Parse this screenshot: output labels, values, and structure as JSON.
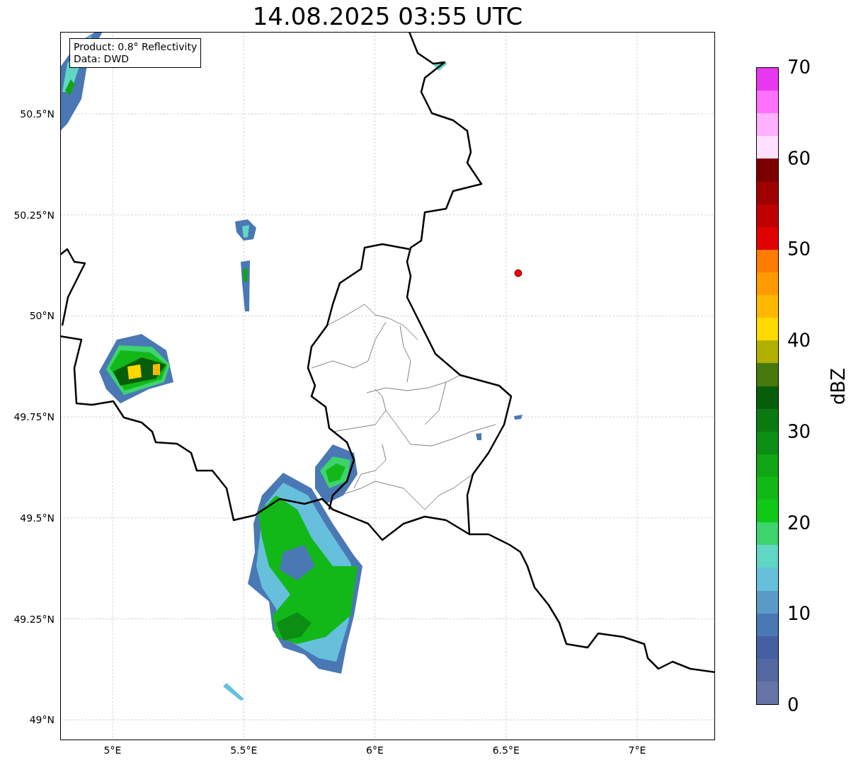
{
  "title": "14.08.2025 03:55 UTC",
  "map": {
    "annotation": [
      "Product: 0.8° Reflectivity",
      "Data: DWD"
    ],
    "y_ticks": [
      "50.5°N",
      "50.25°N",
      "50°N",
      "49.75°N",
      "49.5°N",
      "49.25°N",
      "49°N"
    ],
    "x_ticks": [
      "5°E",
      "5.5°E",
      "6°E",
      "6.5°E",
      "7°E"
    ]
  },
  "colorbar": {
    "label": "dBZ",
    "ticks": [
      "70",
      "60",
      "50",
      "40",
      "30",
      "20",
      "10",
      "0"
    ],
    "bins": [
      {
        "color": "#e838f0"
      },
      {
        "color": "#ff70ff"
      },
      {
        "color": "#ffb0ff"
      },
      {
        "color": "#ffe0ff"
      },
      {
        "color": "#7c0000"
      },
      {
        "color": "#a00000"
      },
      {
        "color": "#c00000"
      },
      {
        "color": "#e00000"
      },
      {
        "color": "#ff7c00"
      },
      {
        "color": "#ff9a00"
      },
      {
        "color": "#ffb800"
      },
      {
        "color": "#ffd800"
      },
      {
        "color": "#b0b000"
      },
      {
        "color": "#467a0c"
      },
      {
        "color": "#075e0a"
      },
      {
        "color": "#0a7a10"
      },
      {
        "color": "#0c8d14"
      },
      {
        "color": "#10a514"
      },
      {
        "color": "#12b818"
      },
      {
        "color": "#10c818"
      },
      {
        "color": "#3dd46e"
      },
      {
        "color": "#62d6c4"
      },
      {
        "color": "#66c0dc"
      },
      {
        "color": "#5a9bc8"
      },
      {
        "color": "#4a78b4"
      },
      {
        "color": "#4460a2"
      },
      {
        "color": "#5368a0"
      },
      {
        "color": "#6674a8"
      }
    ]
  }
}
